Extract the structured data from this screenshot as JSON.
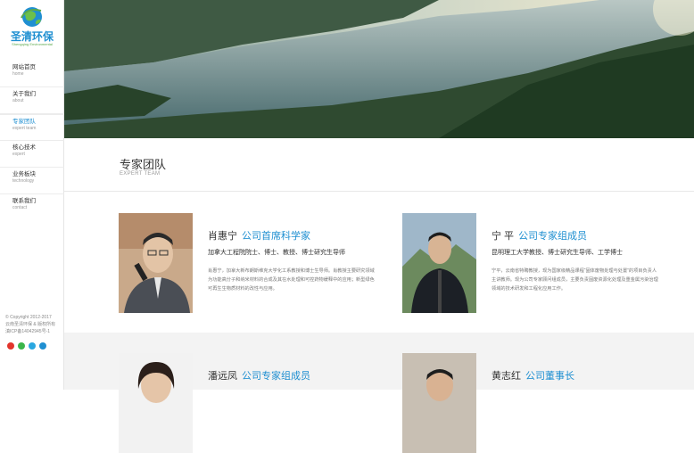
{
  "brand": {
    "logo_text": "圣清环保",
    "logo_sub": "Shengqing Environmental"
  },
  "nav": [
    {
      "zh": "网站首页",
      "en": "home"
    },
    {
      "zh": "关于我们",
      "en": "about"
    },
    {
      "zh": "专家团队",
      "en": "expert team",
      "active": true
    },
    {
      "zh": "核心技术",
      "en": "expert"
    },
    {
      "zh": "业务板块",
      "en": "technology"
    },
    {
      "zh": "联系我们",
      "en": "contact"
    }
  ],
  "footer": {
    "copyright": "© Copyright 2012-2017",
    "company": "云南圣清环保 & 版权所有",
    "icp": "滇ICP备14042945号-1",
    "social_icons": [
      "weibo-icon",
      "wechat-icon",
      "qq-icon",
      "email-icon"
    ]
  },
  "section": {
    "title": "专家团队",
    "subtitle": "EXPERT TEAM"
  },
  "experts": [
    {
      "name": "肖惠宁",
      "role": "公司首席科学家",
      "title": "加拿大工程院院士、博士、教授、博士研究生导师",
      "desc": "肖惠宁，加拿大新布朗斯维克大学化工系教授和博士生导师。肖教授主要研究领域为功能高分子和纳米材料的合成及其在水处理和可控药物缓释中的应用；新型绿色可再生生物质材料的改性与应用。"
    },
    {
      "name": "宁 平",
      "role": "公司专家组成员",
      "title": "昆明理工大学教授、博士研究生导师、工学博士",
      "desc": "宁平，云南省特聘教授，现为国家级精品课程“固体废物处理与处置”的项目负责人主讲教师。现为公司专家顾问组成员，主要负责固废资源化处理及重金属污染治理领域的技术研发和工程化应用工作。"
    },
    {
      "name": "潘远凤",
      "role": "公司专家组成员",
      "title": "",
      "desc": ""
    },
    {
      "name": "黄志红",
      "role": "公司董事长",
      "title": "",
      "desc": ""
    }
  ],
  "colors": {
    "accent": "#1f8fd1",
    "logo_green": "#5aa84b",
    "band": "#f3f3f3"
  }
}
